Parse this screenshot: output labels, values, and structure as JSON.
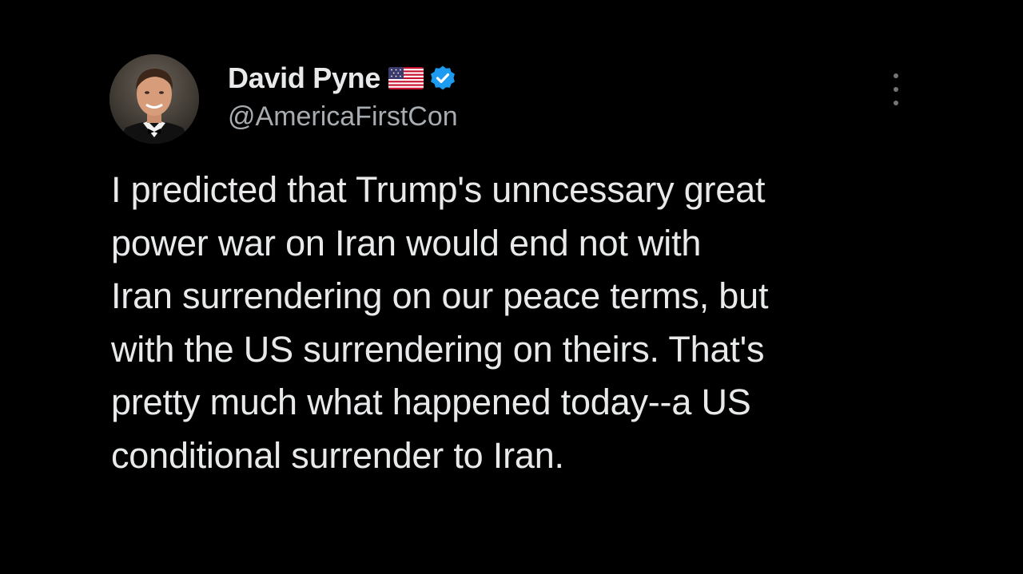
{
  "tweet": {
    "author": {
      "display_name": "David Pyne",
      "handle": "@AmericaFirstCon",
      "flag_icon": "us-flag-icon",
      "verified_icon": "verified-badge-icon",
      "verified_color": "#1d9bf0",
      "avatar_icon": "profile-photo"
    },
    "more_icon": "more-options-icon",
    "text": "I predicted that Trump's unncessary great\npower war on Iran would end not with\nIran surrendering on our peace terms, but\nwith the US surrendering on theirs. That's\npretty much what happened today--a US\nconditional surrender to Iran."
  },
  "colors": {
    "background": "#000000",
    "text_primary": "#e7e9ea",
    "text_secondary": "#a7acb1",
    "accent": "#1d9bf0"
  }
}
